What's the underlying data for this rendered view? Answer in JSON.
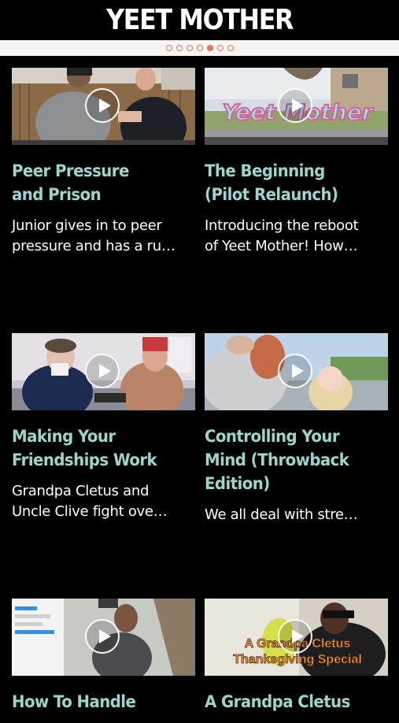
{
  "app": {
    "title": "YEET MOTHER"
  },
  "pager": {
    "total": 7,
    "active_index": 4
  },
  "videos": [
    {
      "title": "Peer Pressure\nand Prison",
      "desc": "Junior gives in to peer\npressure and has a ru…",
      "overlay": ""
    },
    {
      "title": "The Beginning\n(Pilot Relaunch)",
      "desc": "Introducing the reboot\nof Yeet Mother! How…",
      "overlay": "Yeet Mother"
    },
    {
      "title": "Making Your\nFriendships Work",
      "desc": "Grandpa Cletus and\nUncle Clive fight ove…",
      "overlay": ""
    },
    {
      "title": "Controlling Your\nMind (Throwback\nEdition)",
      "desc": "We all deal with stre…",
      "overlay": ""
    },
    {
      "title": "How To Handle",
      "desc": "",
      "overlay": ""
    },
    {
      "title": "A Grandpa Cletus",
      "desc": "",
      "overlay": "A Grandpa Cletus\nThanksgiving Special"
    }
  ],
  "icons": {
    "play": "play-icon"
  },
  "colors": {
    "accent": "#e8745c",
    "title_text": "#9bd6cc",
    "background": "#000000"
  }
}
